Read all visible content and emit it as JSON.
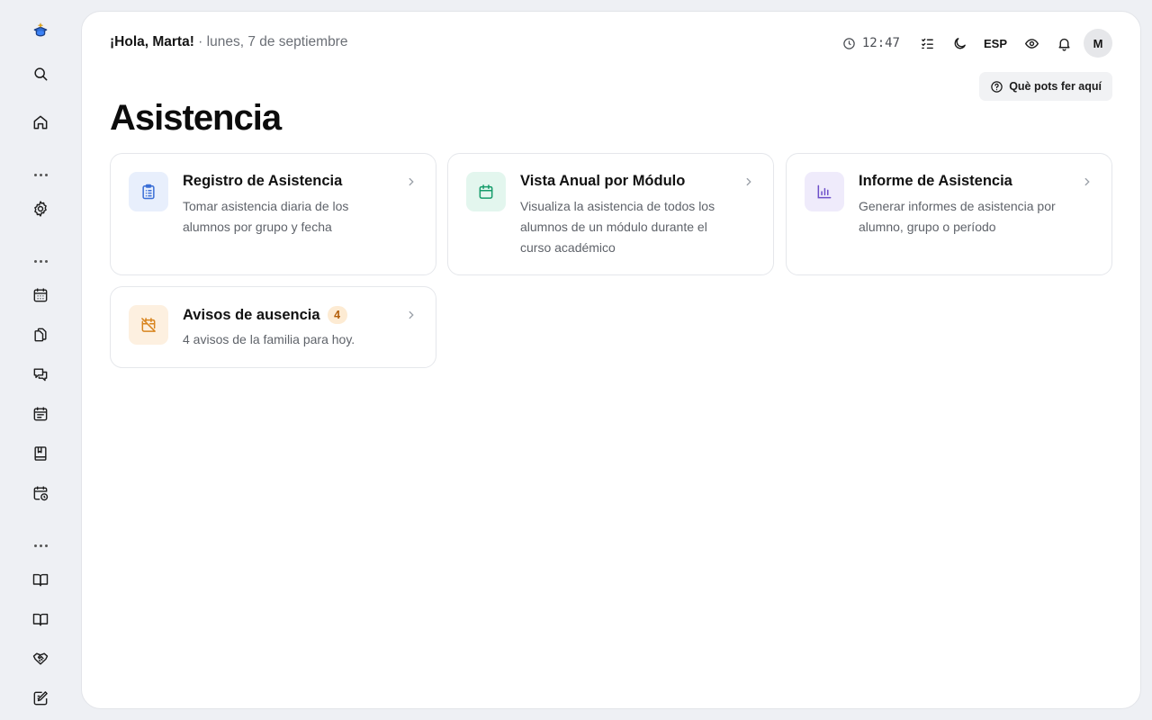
{
  "header": {
    "greeting": "¡Hola, Marta!",
    "date": " · lunes, 7 de septiembre",
    "time": "12:47",
    "language": "ESP",
    "avatar_initial": "M",
    "help_label": "Què pots fer aquí"
  },
  "page": {
    "title": "Asistencia"
  },
  "cards": [
    {
      "title": "Registro de Asistencia",
      "description": "Tomar asistencia diaria de los alumnos por grupo y fecha",
      "icon": "clipboard-list-icon",
      "icon_color": "#3b6fd6",
      "icon_bg": "#e8effc"
    },
    {
      "title": "Vista Anual por Módulo",
      "description": "Visualiza la asistencia de todos los alumnos de un módulo durante el curso académico",
      "icon": "calendar-icon",
      "icon_color": "#169c6b",
      "icon_bg": "#e3f6ee"
    },
    {
      "title": "Informe de Asistencia",
      "description": "Generar informes de asistencia por alumno, grupo o período",
      "icon": "bar-chart-icon",
      "icon_color": "#6d4fc9",
      "icon_bg": "#efebfb"
    },
    {
      "title": "Avisos de ausencia",
      "badge": "4",
      "description": "4 avisos de la familia para hoy.",
      "icon": "calendar-off-icon",
      "icon_color": "#d8841e",
      "icon_bg": "#fdf0e0"
    }
  ],
  "sidebar": {
    "icons": [
      "logo-icon",
      "search-icon",
      "home-icon",
      "settings-icon",
      "calendar-grid-icon",
      "documents-icon",
      "messages-icon",
      "schedule-icon",
      "bookmark-book-icon",
      "calendar-clock-icon",
      "open-book-icon",
      "open-book-icon",
      "handshake-icon",
      "edit-note-icon"
    ]
  }
}
